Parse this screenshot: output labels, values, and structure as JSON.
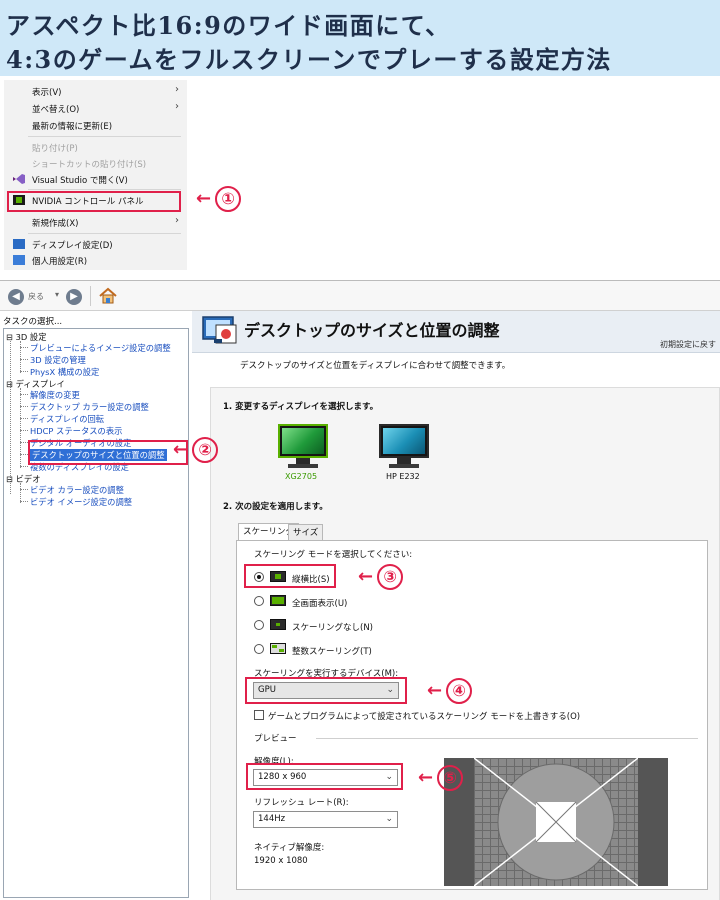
{
  "banner": {
    "line1": "アスペクト比16:9のワイド画面にて、",
    "line2": "4:3のゲームをフルスクリーンでプレーする設定方法"
  },
  "context_menu": {
    "items": [
      {
        "label": "表示(V)",
        "arrow": "›",
        "disabled": false
      },
      {
        "label": "並べ替え(O)",
        "arrow": "›",
        "disabled": false
      },
      {
        "label": "最新の情報に更新(E)",
        "arrow": "",
        "disabled": false
      },
      {
        "label": "貼り付け(P)",
        "arrow": "",
        "disabled": true
      },
      {
        "label": "ショートカットの貼り付け(S)",
        "arrow": "",
        "disabled": true
      },
      {
        "label": "Visual Studio で開く(V)",
        "arrow": "",
        "disabled": false
      },
      {
        "label": "NVIDIA コントロール パネル",
        "arrow": "",
        "disabled": false
      },
      {
        "label": "新規作成(X)",
        "arrow": "›",
        "disabled": false
      },
      {
        "label": "ディスプレイ設定(D)",
        "arrow": "",
        "disabled": false
      },
      {
        "label": "個人用設定(R)",
        "arrow": "",
        "disabled": false
      }
    ]
  },
  "callouts": {
    "arrow": "←",
    "c1": "①",
    "c2": "②",
    "c3": "③",
    "c4": "④",
    "c5": "⑤"
  },
  "toolbar": {
    "back_label": "戻る"
  },
  "left_pane": {
    "header": "タスクの選択...",
    "cat_3d": "3D 設定",
    "item_preview": "プレビューによるイメージ設定の調整",
    "item_3d_manage": "3D 設定の管理",
    "item_physx": "PhysX 構成の設定",
    "cat_display": "ディスプレイ",
    "item_resolution": "解像度の変更",
    "item_color": "デスクトップ カラー設定の調整",
    "item_rotate": "ディスプレイの回転",
    "item_hdcp": "HDCP ステータスの表示",
    "item_digital_audio": "デジタル オーディオの設定",
    "item_size_pos": "デスクトップのサイズと位置の調整",
    "item_multi": "複数のディスプレイの設定",
    "cat_video": "ビデオ",
    "item_video_color": "ビデオ カラー設定の調整",
    "item_video_image": "ビデオ イメージ設定の調整"
  },
  "right_pane": {
    "title": "デスクトップのサイズと位置の調整",
    "reset": "初期設定に戻す",
    "description": "デスクトップのサイズと位置をディスプレイに合わせて調整できます。",
    "section1": "1. 変更するディスプレイを選択します。",
    "monitors": [
      {
        "label": "XG2705",
        "selected": true
      },
      {
        "label": "HP E232",
        "selected": false
      }
    ],
    "section2": "2. 次の設定を適用します。",
    "tabs": [
      "スケーリング",
      "サイズ"
    ],
    "scaling_prompt": "スケーリング モードを選択してください:",
    "modes": [
      {
        "label": "縦横比(S)",
        "selected": true
      },
      {
        "label": "全画面表示(U)",
        "selected": false
      },
      {
        "label": "スケーリングなし(N)",
        "selected": false
      },
      {
        "label": "整数スケーリング(T)",
        "selected": false
      }
    ],
    "device_label": "スケーリングを実行するデバイス(M):",
    "device_value": "GPU",
    "override_label": "ゲームとプログラムによって設定されているスケーリング モードを上書きする(O)",
    "preview_label": "プレビュー",
    "resolution_label": "解像度(L):",
    "resolution_value": "1280 x 960",
    "refresh_label": "リフレッシュ レート(R):",
    "refresh_value": "144Hz",
    "native_label": "ネイティブ解像度:",
    "native_value": "1920 x 1080"
  },
  "colors": {
    "accent_red": "#e0204a",
    "nvidia_green": "#59b000",
    "selection_blue": "#2f6fd6",
    "banner_bg": "#cfe8f8"
  }
}
